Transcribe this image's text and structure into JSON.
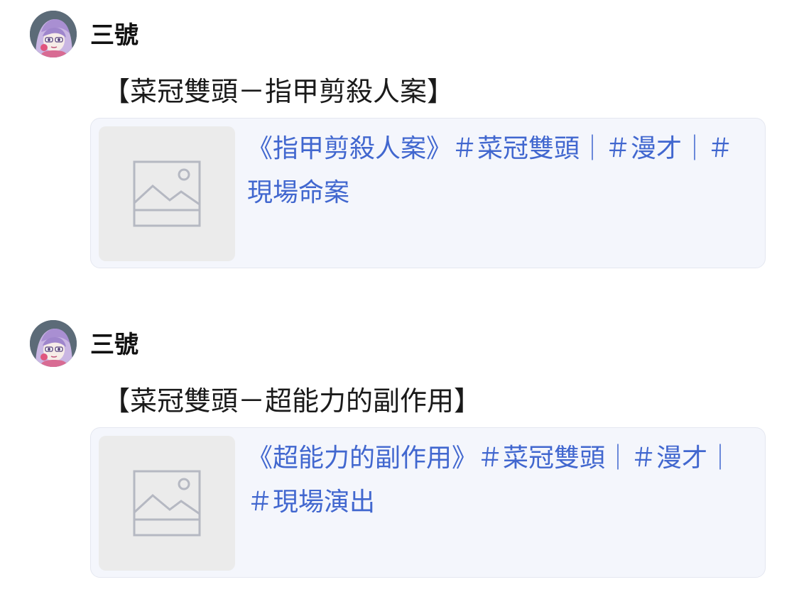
{
  "messages": [
    {
      "username": "三號",
      "avatar_icon": "anime-character-avatar-icon",
      "title": "【菜冠雙頭－指甲剪殺人案】",
      "link_preview": {
        "thumbnail_icon": "image-placeholder-icon",
        "text": "《指甲剪殺人案》＃菜冠雙頭｜＃漫才｜＃現場命案"
      }
    },
    {
      "username": "三號",
      "avatar_icon": "anime-character-avatar-icon",
      "title": "【菜冠雙頭－超能力的副作用】",
      "link_preview": {
        "thumbnail_icon": "image-placeholder-icon",
        "text": "《超能力的副作用》＃菜冠雙頭｜＃漫才｜＃現場演出"
      }
    }
  ],
  "colors": {
    "link": "#4167cf",
    "card_background": "#f4f6fc",
    "thumbnail_background": "#ebebeb",
    "placeholder_stroke": "#b5b8c2"
  }
}
